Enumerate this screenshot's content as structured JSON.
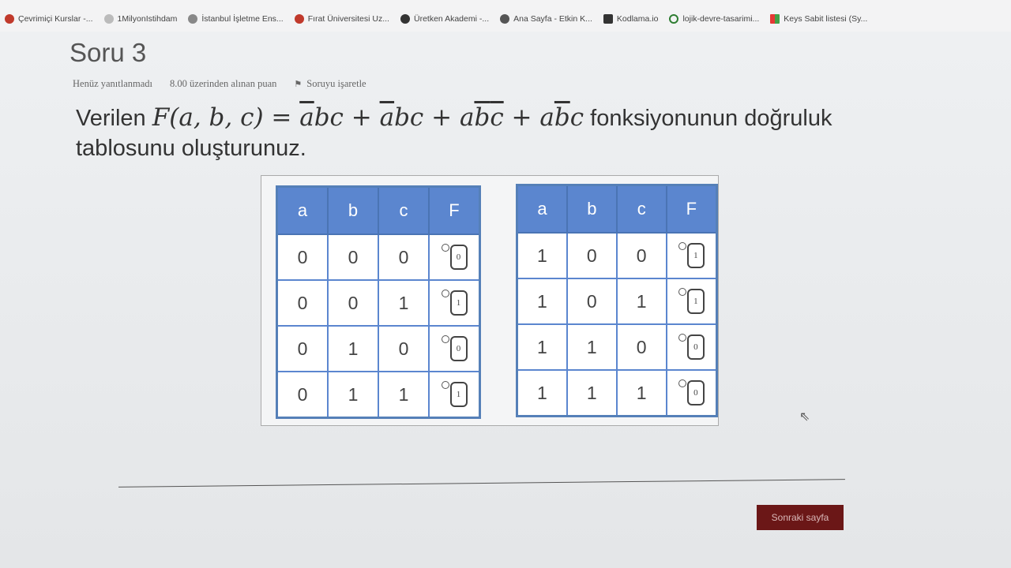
{
  "bookmarks": [
    {
      "label": "Çevrimiçi Kurslar -...",
      "icon": "course-icon",
      "color": "#c0392b"
    },
    {
      "label": "1MilyonIstihdam",
      "icon": "globe-icon",
      "color": "#999999"
    },
    {
      "label": "İstanbul İşletme Ens...",
      "icon": "pin-icon",
      "color": "#777777"
    },
    {
      "label": "Fırat Üniversitesi Uz...",
      "icon": "university-icon",
      "color": "#c0392b"
    },
    {
      "label": "Üretken Akademi -...",
      "icon": "academy-icon",
      "color": "#333333"
    },
    {
      "label": "Ana Sayfa - Etkin K...",
      "icon": "home-icon",
      "color": "#555555"
    },
    {
      "label": "Kodlama.io",
      "icon": "code-icon",
      "color": "#333333"
    },
    {
      "label": "lojik-devre-tasarimi...",
      "icon": "circle-icon",
      "color": "#2e7d32"
    },
    {
      "label": "Keys Sabit listesi (Sy...",
      "icon": "windows-icon",
      "color": "#e53935"
    }
  ],
  "question": {
    "title": "Soru 3",
    "status": "Henüz yanıtlanmadı",
    "points": "8.00 üzerinden alınan puan",
    "flag_label": "Soruyu işaretle",
    "prefix": "Verilen",
    "formula_lhs": "F(a, b, c) = ",
    "suffix": "fonksiyonunun doğruluk tablosunu oluşturunuz."
  },
  "truth_table": {
    "headers": [
      "a",
      "b",
      "c",
      "F"
    ],
    "left_rows": [
      {
        "a": "0",
        "b": "0",
        "c": "0",
        "f": "0"
      },
      {
        "a": "0",
        "b": "0",
        "c": "1",
        "f": "1"
      },
      {
        "a": "0",
        "b": "1",
        "c": "0",
        "f": "0"
      },
      {
        "a": "0",
        "b": "1",
        "c": "1",
        "f": "1"
      }
    ],
    "right_rows": [
      {
        "a": "1",
        "b": "0",
        "c": "0",
        "f": "1"
      },
      {
        "a": "1",
        "b": "0",
        "c": "1",
        "f": "1"
      },
      {
        "a": "1",
        "b": "1",
        "c": "0",
        "f": "0"
      },
      {
        "a": "1",
        "b": "1",
        "c": "1",
        "f": "0"
      }
    ]
  },
  "footer": {
    "next_label": "Sonraki sayfa"
  }
}
